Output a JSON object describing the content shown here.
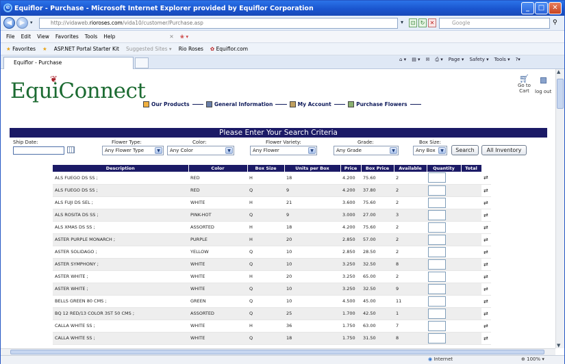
{
  "browser": {
    "title": "Equiflor - Purchase - Microsoft Internet Explorer provided by Equiflor Corporation",
    "url_prefix": "http://vidaweb.",
    "url_domain": "rioroses.com",
    "url_suffix": "/vida10/customer/Purchase.asp",
    "search_placeholder": "Google",
    "menu": [
      "File",
      "Edit",
      "View",
      "Favorites",
      "Tools",
      "Help"
    ],
    "favorites_label": "Favorites",
    "favorites_links": [
      "ASP.NET Portal Starter Kit",
      "Suggested Sites ▾",
      "Rio Roses",
      "Equiflor.com"
    ],
    "tab_label": "Equiflor - Purchase",
    "commands": [
      "Page ▾",
      "Safety ▾",
      "Tools ▾"
    ],
    "status_zone": "Internet",
    "zoom": "100%"
  },
  "site": {
    "logo": "EquiConnect",
    "nav": [
      "Our Products",
      "General Information",
      "My Account",
      "Purchase Flowers"
    ],
    "cart_label_1": "Go to",
    "cart_label_2": "Cart",
    "logout_label": "log out",
    "banner": "Please Enter Your Search Criteria"
  },
  "filters": {
    "ship_date_label": "Ship Date:",
    "flower_type_label": "Flower Type:",
    "flower_type_value": "Any Flower Type",
    "color_label": "Color:",
    "color_value": "Any Color",
    "variety_label": "Flower Variety:",
    "variety_value": "Any Flower",
    "grade_label": "Grade:",
    "grade_value": "Any Grade",
    "box_size_label": "Box Size:",
    "box_size_value": "Any Box",
    "search_button": "Search",
    "all_inventory_button": "All Inventory"
  },
  "table": {
    "columns": [
      "Description",
      "Color",
      "Box Size",
      "Units per Box",
      "Price",
      "Box Price",
      "Available",
      "Quantity",
      "Total"
    ],
    "rows": [
      [
        "ALS FUEGO DS SS ;",
        "RED",
        "H",
        "18",
        "4.200",
        "75.60",
        "2"
      ],
      [
        "ALS FUEGO DS SS ;",
        "RED",
        "Q",
        "9",
        "4.200",
        "37.80",
        "2"
      ],
      [
        "ALS FUJI DS SEL ;",
        "WHITE",
        "H",
        "21",
        "3.600",
        "75.60",
        "2"
      ],
      [
        "ALS ROSITA DS SS ;",
        "PINK-HOT",
        "Q",
        "9",
        "3.000",
        "27.00",
        "3"
      ],
      [
        "ALS XMAS DS SS ;",
        "ASSORTED",
        "H",
        "18",
        "4.200",
        "75.60",
        "2"
      ],
      [
        "ASTER PURPLE MONARCH ;",
        "PURPLE",
        "H",
        "20",
        "2.850",
        "57.00",
        "2"
      ],
      [
        "ASTER SOLIDAGO ;",
        "YELLOW",
        "Q",
        "10",
        "2.850",
        "28.50",
        "2"
      ],
      [
        "ASTER SYMPHONY ;",
        "WHITE",
        "Q",
        "10",
        "3.250",
        "32.50",
        "8"
      ],
      [
        "ASTER WHITE ;",
        "WHITE",
        "H",
        "20",
        "3.250",
        "65.00",
        "2"
      ],
      [
        "ASTER WHITE ;",
        "WHITE",
        "Q",
        "10",
        "3.250",
        "32.50",
        "9"
      ],
      [
        "BELLS GREEN 80 CMS ;",
        "GREEN",
        "Q",
        "10",
        "4.500",
        "45.00",
        "11"
      ],
      [
        "BQ 12 RED/13 COLOR 3ST 50 CMS ;",
        "ASSORTED",
        "Q",
        "25",
        "1.700",
        "42.50",
        "1"
      ],
      [
        "CALLA WHITE SS ;",
        "WHITE",
        "H",
        "36",
        "1.750",
        "63.00",
        "7"
      ],
      [
        "CALLA WHITE SS ;",
        "WHITE",
        "Q",
        "18",
        "1.750",
        "31.50",
        "8"
      ]
    ]
  }
}
